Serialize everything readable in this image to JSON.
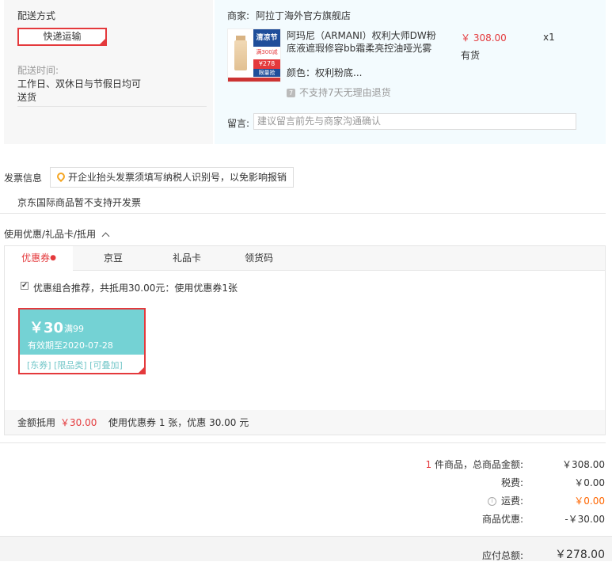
{
  "shipping": {
    "heading": "配送方式",
    "method_label": "快递运输",
    "time_heading": "配送时间:",
    "time_text_line1": "工作日、双休日与节假日均可",
    "time_text_line2": "送货"
  },
  "order": {
    "merchant_label": "商家:",
    "merchant_name": "阿拉丁海外官方旗舰店",
    "product_name_line1": "阿玛尼（ARMANI）权利大师DW粉",
    "product_name_line2": "底液遮瑕修容bb霜柔亮控油哑光雾",
    "price": "￥ 308.00",
    "quantity": "x1",
    "stock": "有货",
    "color_label": "颜色：权利粉底...",
    "return_policy": "不支持7天无理由退货",
    "note_label": "留言:",
    "note_placeholder": "建议留言前先与商家沟通确认",
    "image_text": {
      "banner": "清凉节",
      "tag1": "满300减30",
      "tag2": "¥278",
      "tag3": "限量抢"
    }
  },
  "invoice": {
    "heading": "发票信息",
    "tip": "开企业抬头发票须填写纳税人识别号，以免影响报销",
    "notice": "京东国际商品暂不支持开发票"
  },
  "discounts": {
    "heading": "使用优惠/礼品卡/抵用",
    "tabs": [
      {
        "label": "优惠券",
        "active": true
      },
      {
        "label": "京豆",
        "active": false
      },
      {
        "label": "礼品卡",
        "active": false
      },
      {
        "label": "领货码",
        "active": false
      }
    ],
    "combo_text": "优惠组合推荐，共抵用30.00元：使用优惠券1张",
    "combo_checked": true,
    "coupon": {
      "amount": "￥30",
      "condition": "满99",
      "expiry": "有效期至2020-07-28",
      "tags": "[东券] [限品类] [可叠加]"
    },
    "footer_label": "金额抵用",
    "footer_amount": "￥30.00",
    "footer_summary": "使用优惠券 1 张，优惠 30.00 元"
  },
  "totals": {
    "count": "1",
    "count_suffix": "件商品，总商品金额:",
    "goods_amount": "￥308.00",
    "tax_label": "税费:",
    "tax": "￥0.00",
    "shipping_label": "运费:",
    "shipping_fee": "￥0.00",
    "promo_label": "商品优惠:",
    "promo": "-￥30.00",
    "payable_label": "应付总额:",
    "payable": "￥278.00"
  },
  "colors": {
    "accent": "#e4393c",
    "coupon": "#74d2d4",
    "shipping_orange": "#f60"
  }
}
